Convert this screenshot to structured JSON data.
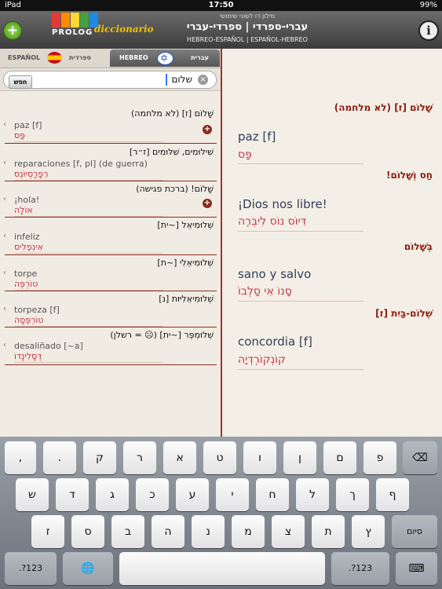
{
  "status_bar": {
    "carrier": "iPad",
    "time": "17:50",
    "battery": "99%"
  },
  "header": {
    "logo_word": "PROLOG",
    "logo_sub": "diccionario",
    "small_caption": "מילון דו לשוני שימושי",
    "title": "עברי-ספרדי | ספרדי-עברי",
    "subtitle": "HEBREO-ESPAÑOL | ESPAÑOL-HEBREO",
    "add_label": "+",
    "info_label": "i"
  },
  "tabs": [
    {
      "latin": "ESPAÑOL",
      "hebrew": "ספרדית"
    },
    {
      "latin": "HEBREO",
      "hebrew": "עברית"
    }
  ],
  "search": {
    "button": "חפש",
    "value": "שלום",
    "clear": "×"
  },
  "results": {
    "r0": "שָׁלוֹם [ז] (לא מלחמה)",
    "t0": {
      "es": "paz [f]",
      "he": "פַּס"
    },
    "r1": "שִׁילוּמִים, שִׁלּוּמִים [ז״ר]",
    "t1": {
      "es": "reparaciones [f, pl] (de guerra)",
      "he": "רֵפָּרָסְיוֹנֶס"
    },
    "r2": "שָׁלוֹם! (ברכת פגישה)",
    "t2": {
      "es": "¡hola!",
      "he": "אוֹלָה"
    },
    "r3": "שְׁלוּמִיאֵל [~ית]",
    "t3": {
      "es": "infeliz",
      "he": "אִינְפֶלִיס"
    },
    "r4": "שְׁלוּמִיאֵלִי [~ת]",
    "t4": {
      "es": "torpe",
      "he": "טוֹרְפֶּה"
    },
    "r5": "שְׁלוּמִיאֵלִיּוּת [נ]",
    "t5": {
      "es": "torpeza [f]",
      "he": "טוֹרְפֶּסָה"
    },
    "r6": "שְׁלוּמְפֶּר [~ית] (☹ = רשלן)",
    "t6": {
      "es": "desaliñado [~a]",
      "he": "דֶּסָלִינָדוֹ"
    }
  },
  "detail": [
    {
      "head": "שָׁלוֹם [ז] (לא מלחמה)",
      "es": "paz [f]",
      "he": "פַּס"
    },
    {
      "head": "חַס וְשָׁלוֹם!",
      "es": "¡Dios nos libre!",
      "he": "דִּיוֹס נוֹס לִיבְּרֶה"
    },
    {
      "head": "בְּשָׁלוֹם",
      "es": "sano y salvo",
      "he": "סָנוֹ אִי סַלְבוֹ"
    },
    {
      "head": "שְׁלוֹם-בַּיִת [ז]",
      "es": "concordia [f]",
      "he": "קוֹנְקוֹרְדְיָה"
    }
  ],
  "keyboard": {
    "row1": [
      ",",
      ".",
      "ק",
      "ר",
      "א",
      "ט",
      "ו",
      "ן",
      "ם",
      "פ",
      "⌫"
    ],
    "row2": [
      "ש",
      "ד",
      "ג",
      "כ",
      "ע",
      "י",
      "ח",
      "ל",
      "ך",
      "ף"
    ],
    "row3": [
      "ז",
      "ס",
      "ב",
      "ה",
      "נ",
      "מ",
      "צ",
      "ת",
      "ץ",
      "סיום"
    ],
    "row4": [
      ".?123",
      "🌐",
      "",
      ".?123",
      "⌨"
    ]
  }
}
